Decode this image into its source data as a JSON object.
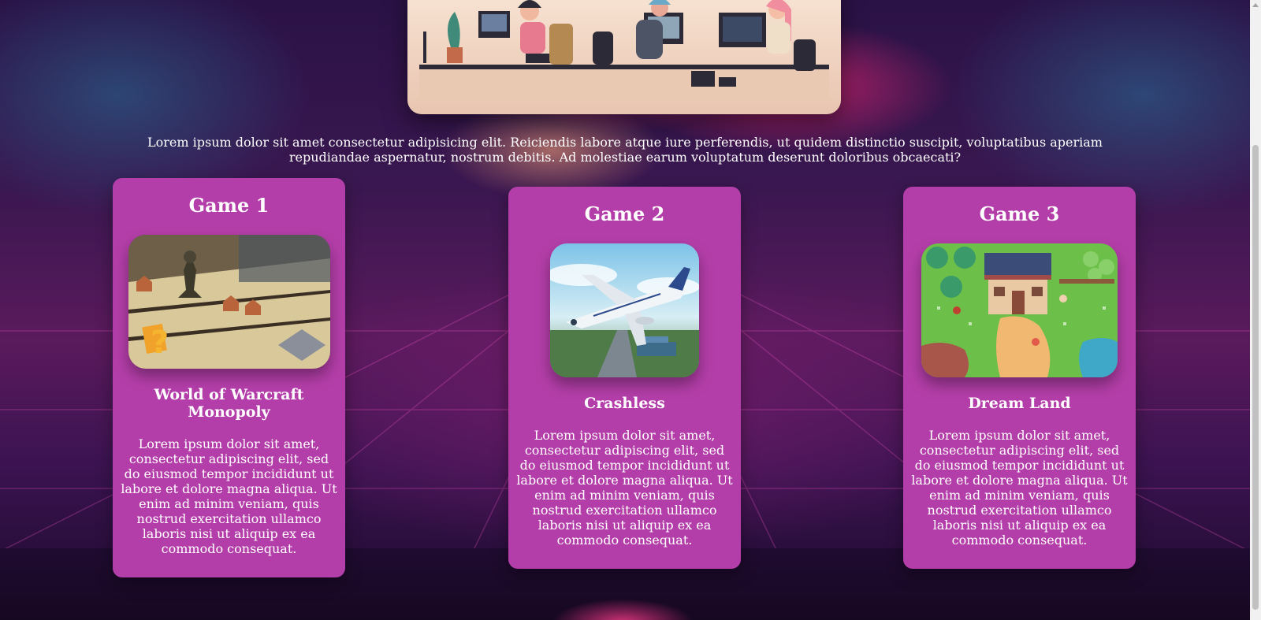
{
  "intro": {
    "text": "Lorem ipsum dolor sit amet consectetur adipisicing elit. Reiciendis labore atque iure perferendis, ut quidem distinctio suscipit, voluptatibus aperiam repudiandae aspernatur, nostrum debitis. Ad molestiae earum voluptatum deserunt doloribus obcaecati?"
  },
  "hero": {
    "image_subject": "illustration of people working at computers"
  },
  "games": [
    {
      "heading": "Game 1",
      "name": "World of Warcraft Monopoly",
      "description": "Lorem ipsum dolor sit amet, consectetur adipiscing elit, sed do eiusmod tempor incididunt ut labore et dolore magna aliqua. Ut enim ad minim veniam, quis nostrud exercitation ullamco laboris nisi ut aliquip ex ea commodo consequat.",
      "image_subject": "board game photo"
    },
    {
      "heading": "Game 2",
      "name": "Crashless",
      "description": "Lorem ipsum dolor sit amet, consectetur adipiscing elit, sed do eiusmod tempor incididunt ut labore et dolore magna aliqua. Ut enim ad minim veniam, quis nostrud exercitation ullamco laboris nisi ut aliquip ex ea commodo consequat.",
      "image_subject": "airplane flying over runway"
    },
    {
      "heading": "Game 3",
      "name": "Dream Land",
      "description": "Lorem ipsum dolor sit amet, consectetur adipiscing elit, sed do eiusmod tempor incididunt ut labore et dolore magna aliqua. Ut enim ad minim veniam, quis nostrud exercitation ullamco laboris nisi ut aliquip ex ea commodo consequat.",
      "image_subject": "pixel art farm village"
    }
  ],
  "colors": {
    "card_background": "#b43ea9",
    "text": "#ffffff"
  }
}
